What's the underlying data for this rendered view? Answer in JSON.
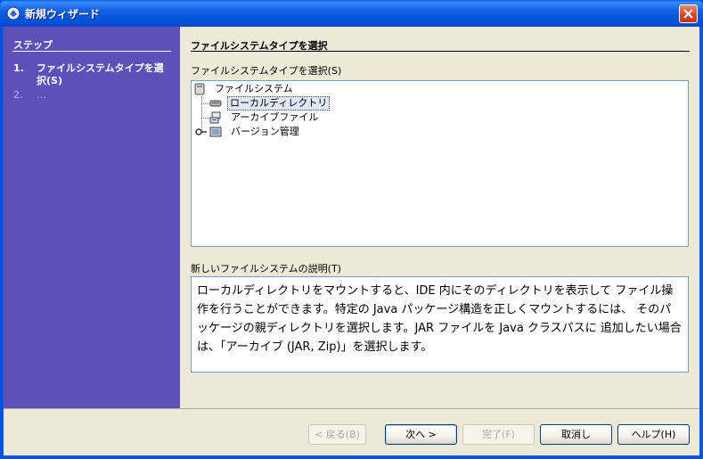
{
  "window": {
    "title": "新規ウィザード"
  },
  "steps": {
    "title": "ステップ",
    "items": [
      {
        "num": "1.",
        "label": "ファイルシステムタイプを選択(S)"
      },
      {
        "num": "2.",
        "label": "..."
      }
    ]
  },
  "main": {
    "heading": "ファイルシステムタイプを選択",
    "type_label": "ファイルシステムタイプを選択(S)",
    "tree": {
      "root": "ファイルシステム",
      "items": [
        "ローカルディレクトリ",
        "アーカイブファイル",
        "バージョン管理"
      ],
      "selected": "ローカルディレクトリ"
    },
    "description_label": "新しいファイルシステムの説明(T)",
    "description": "ローカルディレクトリをマウントすると、IDE 内にそのディレクトリを表示して ファイル操作を行うことができます。特定の Java パッケージ構造を正しくマウントするには、 そのパッケージの親ディレクトリを選択します。JAR ファイルを Java クラスパスに 追加したい場合は、「アーカイブ (JAR, Zip)」を選択します。"
  },
  "buttons": {
    "back": "< 戻る(B)",
    "next": "次へ >",
    "finish": "完了(F)",
    "cancel": "取消し",
    "help": "ヘルプ(H)"
  },
  "colors": {
    "titlebar": "#0054e3",
    "steps_panel": "#5f50b9",
    "dialog_bg": "#ece9d8",
    "close_button": "#d6451f"
  },
  "icons": [
    "wizard-icon",
    "close-icon",
    "filesystem-icon",
    "local-directory-icon",
    "archive-file-icon",
    "version-control-icon",
    "expand-handle-icon"
  ]
}
